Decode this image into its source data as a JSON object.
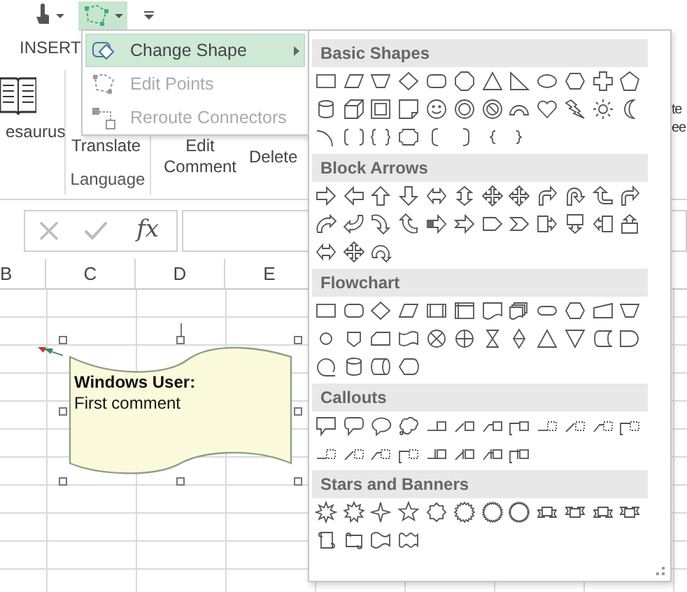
{
  "quick_access_toolbar": [
    {
      "selected": false
    },
    {
      "selected": true
    },
    {
      "selected": false
    }
  ],
  "ribbon_tabs": [
    {
      "label": "INSERT"
    }
  ],
  "ribbon": {
    "groups": [
      {
        "buttons": [
          {
            "label": "esaurus"
          }
        ]
      },
      {
        "label": "Language",
        "buttons": [
          {
            "label": "Translate"
          }
        ]
      },
      {
        "buttons": [
          {
            "label": "Edit Comment"
          },
          {
            "label": "Delete"
          }
        ]
      }
    ],
    "edge_texts": [
      "te",
      "ee"
    ]
  },
  "formula_bar": {
    "function_label": "fx"
  },
  "columns": [
    "B",
    "C",
    "D",
    "E"
  ],
  "comment": {
    "author": "Windows User:",
    "text": "First comment"
  },
  "menu": {
    "items": [
      {
        "label": "Change Shape",
        "selected": true,
        "disabled": false,
        "submenu": true
      },
      {
        "label": "Edit Points",
        "selected": false,
        "disabled": true,
        "submenu": false
      },
      {
        "label": "Reroute Connectors",
        "selected": false,
        "disabled": true,
        "submenu": false
      }
    ]
  },
  "shape_gallery": {
    "sections": [
      {
        "title": "Basic Shapes"
      },
      {
        "title": "Block Arrows"
      },
      {
        "title": "Flowchart"
      },
      {
        "title": "Callouts"
      },
      {
        "title": "Stars and Banners"
      }
    ]
  }
}
